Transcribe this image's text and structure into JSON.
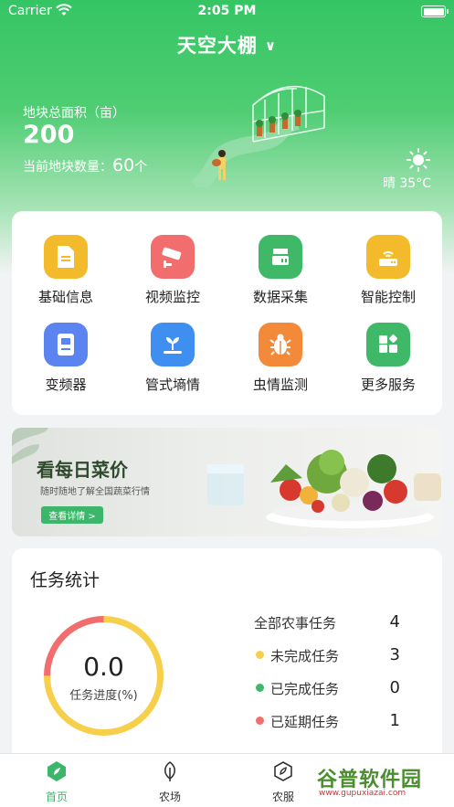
{
  "status_bar": {
    "carrier": "Carrier",
    "time": "2:05 PM"
  },
  "header": {
    "farm_name": "天空大棚",
    "chevron": "∨"
  },
  "summary": {
    "area_label": "地块总面积（亩）",
    "area_value": "200",
    "plot_label": "当前地块数量：",
    "plot_count": "60",
    "plot_unit": "个"
  },
  "weather": {
    "text": "晴 35°C",
    "icon": "sun-icon"
  },
  "services": [
    {
      "label": "基础信息",
      "icon": "document-icon",
      "color": "#f3bb2b"
    },
    {
      "label": "视频监控",
      "icon": "camera-icon",
      "color": "#f26d6d"
    },
    {
      "label": "数据采集",
      "icon": "server-icon",
      "color": "#3fb968"
    },
    {
      "label": "智能控制",
      "icon": "router-icon",
      "color": "#f3bb2b"
    },
    {
      "label": "变频器",
      "icon": "inverter-icon",
      "color": "#5b84f0"
    },
    {
      "label": "管式墒情",
      "icon": "sprout-icon",
      "color": "#3f8ff0"
    },
    {
      "label": "虫情监测",
      "icon": "bug-icon",
      "color": "#f28a3a"
    },
    {
      "label": "更多服务",
      "icon": "grid-icon",
      "color": "#3fb968"
    }
  ],
  "banner": {
    "title": "看每日菜价",
    "subtitle": "随时随地了解全国蔬菜行情",
    "button": "查看详情 >"
  },
  "tasks": {
    "title": "任务统计",
    "progress_value": "0.0",
    "progress_label": "任务进度(%)",
    "ring_segments": [
      {
        "name": "未完成任务",
        "value": 3,
        "color": "#f7d04b"
      },
      {
        "name": "已完成任务",
        "value": 0,
        "color": "#3fb968"
      },
      {
        "name": "已延期任务",
        "value": 1,
        "color": "#f26d6d"
      }
    ],
    "rows": [
      {
        "name": "全部农事任务",
        "value": "4",
        "color": ""
      },
      {
        "name": "未完成任务",
        "value": "3",
        "color": "#f7d04b"
      },
      {
        "name": "已完成任务",
        "value": "0",
        "color": "#3fb968"
      },
      {
        "name": "已延期任务",
        "value": "1",
        "color": "#f26d6d"
      }
    ]
  },
  "tabs": [
    {
      "label": "首页",
      "icon": "home-icon",
      "active": true
    },
    {
      "label": "农场",
      "icon": "leaf-icon",
      "active": false
    },
    {
      "label": "农服",
      "icon": "service-icon",
      "active": false
    }
  ],
  "watermark": {
    "brand": "谷普软件园",
    "url": "www.gupuxiazai.com"
  }
}
